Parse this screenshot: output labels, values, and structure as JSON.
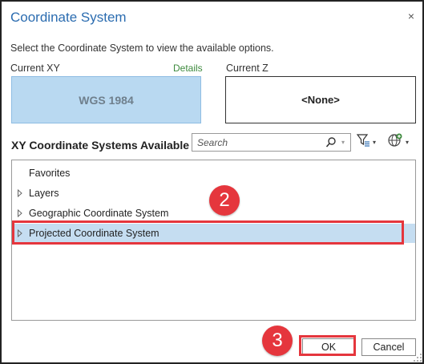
{
  "dialog": {
    "title": "Coordinate System",
    "close_glyph": "×",
    "instruction": "Select the Coordinate System to view the available options."
  },
  "current_xy": {
    "label": "Current XY",
    "details_link": "Details",
    "value": "WGS 1984"
  },
  "current_z": {
    "label": "Current Z",
    "value": "<None>"
  },
  "available": {
    "title": "XY Coordinate Systems Available",
    "search_placeholder": "Search",
    "icons": [
      "search-icon",
      "filter-icon",
      "globe-icon"
    ]
  },
  "tree": {
    "items": [
      {
        "label": "Favorites",
        "expandable": false
      },
      {
        "label": "Layers",
        "expandable": true
      },
      {
        "label": "Geographic Coordinate System",
        "expandable": true
      },
      {
        "label": "Projected Coordinate System",
        "expandable": true,
        "selected": true
      }
    ]
  },
  "annotations": {
    "step_2": "2",
    "step_3": "3",
    "color": "#e5363d"
  },
  "buttons": {
    "ok": "OK",
    "cancel": "Cancel"
  },
  "colors": {
    "title": "#2b6cb0",
    "details": "#3d8a3d",
    "xy_box": "#b9d9f1",
    "selected_row": "#c5ddf1"
  }
}
